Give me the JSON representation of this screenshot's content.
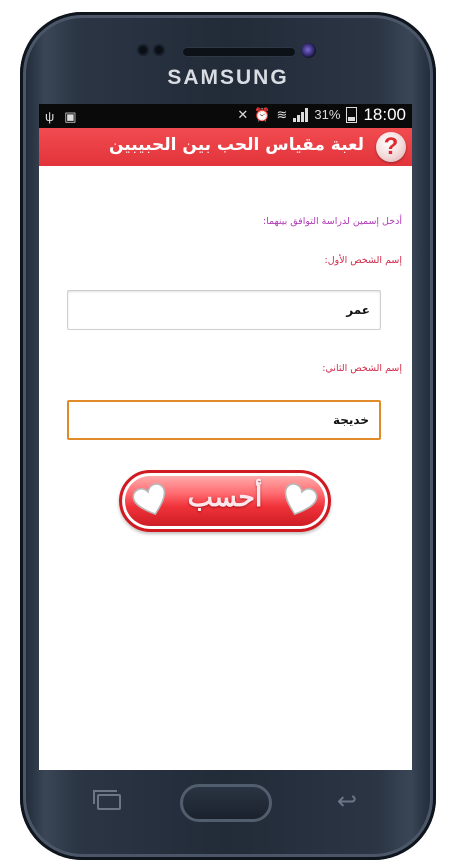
{
  "device": {
    "brand": "SAMSUNG"
  },
  "status_bar": {
    "battery_percent": "31%",
    "time": "18:00",
    "icons": [
      "usb-icon",
      "image-icon",
      "mute-icon",
      "alarm-icon",
      "wifi-icon",
      "signal-icon",
      "battery-icon"
    ]
  },
  "app": {
    "title": "لعبة مقياس الحب بين الحبيبين",
    "help_icon": "?",
    "accent_color": "#e8393f"
  },
  "form": {
    "instruction": "أدخل إسمين لدراسة التوافق بينهما:",
    "first_label": "إسم الشخص الأول:",
    "first_value": "عمر",
    "second_label": "إسم الشخص الثاني:",
    "second_value": "خديجة",
    "calculate_label": "أحسب"
  },
  "nav": {
    "icons": [
      "recent-apps-icon",
      "home-button",
      "back-icon"
    ]
  }
}
